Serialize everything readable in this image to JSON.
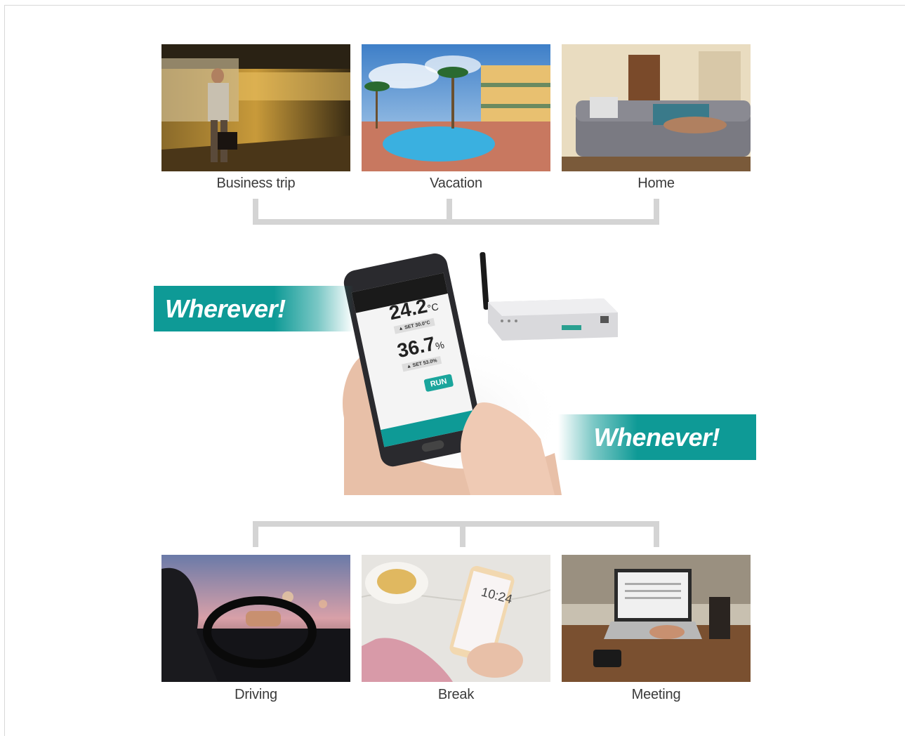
{
  "top_scenes": [
    {
      "label": "Business trip",
      "icon": "subway-platform-photo"
    },
    {
      "label": "Vacation",
      "icon": "resort-pool-photo"
    },
    {
      "label": "Home",
      "icon": "living-room-sofa-photo"
    }
  ],
  "bottom_scenes": [
    {
      "label": "Driving",
      "icon": "car-driving-photo"
    },
    {
      "label": "Break",
      "icon": "coffee-break-phone-photo"
    },
    {
      "label": "Meeting",
      "icon": "laptop-meeting-photo"
    }
  ],
  "banners": {
    "left": "Wherever!",
    "right": "Whenever!"
  },
  "phone_app": {
    "temperature": "24.2",
    "temperature_unit": "°C",
    "temperature_set": "▲ SET 30.0°C",
    "humidity": "36.7",
    "humidity_unit": "%",
    "humidity_set": "▲ SET 53.0%",
    "run_button": "RUN",
    "break_phone_time": "10:24"
  },
  "colors": {
    "accent": "#0e9a96",
    "bracket": "#d4d4d4",
    "caption_text": "#3a3a3a"
  }
}
